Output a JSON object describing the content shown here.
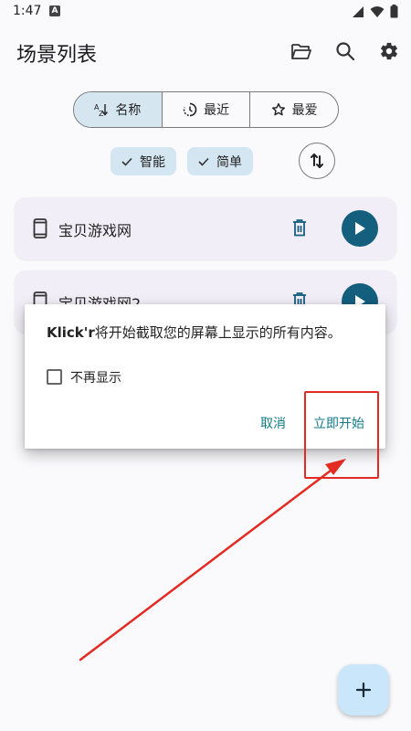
{
  "status_bar": {
    "time": "1:47",
    "notification_badge": "A"
  },
  "app_bar": {
    "title": "场景列表",
    "icons": [
      "folder-open-icon",
      "search-icon",
      "gear-icon"
    ]
  },
  "sort_tabs": [
    {
      "label": "名称",
      "icon": "az-sort-icon",
      "selected": true
    },
    {
      "label": "最近",
      "icon": "clock-icon",
      "selected": false
    },
    {
      "label": "最爱",
      "icon": "star-icon",
      "selected": false
    }
  ],
  "filter_chips": [
    {
      "label": "智能",
      "checked": true
    },
    {
      "label": "简单",
      "checked": true
    }
  ],
  "scenarios": [
    {
      "name": "宝贝游戏网"
    },
    {
      "name": "宝贝游戏网2"
    }
  ],
  "dialog": {
    "app_name": "Klick'r",
    "message": "将开始截取您的屏幕上显示的所有内容。",
    "checkbox_label": "不再显示",
    "checkbox_checked": false,
    "cancel_label": "取消",
    "confirm_label": "立即开始"
  },
  "colors": {
    "accent": "#145e7e",
    "dialog_button": "#117a86",
    "chip_bg": "#d4e6f1",
    "card_bg": "#f2eef7",
    "fab_bg": "#c9e6fb",
    "annotation_red": "#e22b22"
  }
}
